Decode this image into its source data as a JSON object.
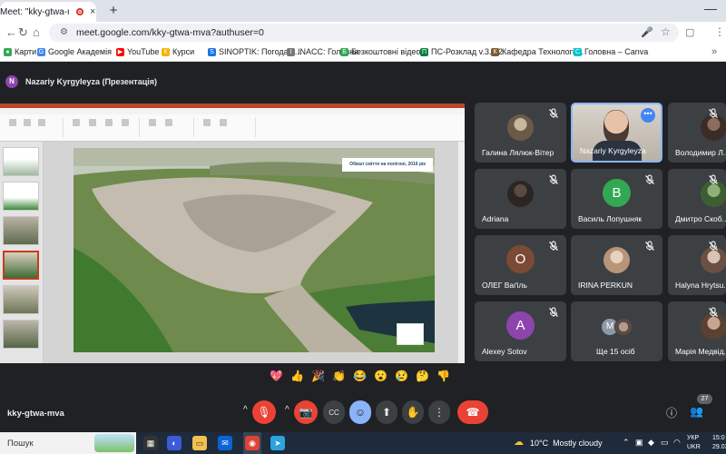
{
  "browser": {
    "tab_title": "Meet: \"kky-gtwa-mva\"",
    "tab_close": "×",
    "new_tab": "+",
    "minimize": "—",
    "url": "meet.google.com/kky-gtwa-mva?authuser=0",
    "back": "←",
    "forward": "→",
    "reload": "↻",
    "home": "⌂",
    "star": "☆",
    "menu": "⋮"
  },
  "bookmarks": [
    {
      "label": "Карти",
      "color": "#34a853",
      "glyph": "●"
    },
    {
      "label": "Google Академія",
      "color": "#4285f4",
      "glyph": "G"
    },
    {
      "label": "YouTube",
      "color": "#ff0000",
      "glyph": "▶"
    },
    {
      "label": "Курси",
      "color": "#f4b400",
      "glyph": "К"
    },
    {
      "label": "SINOPTIK: Погода в...",
      "color": "#1a73e8",
      "glyph": "S"
    },
    {
      "label": "INACC: Головна",
      "color": "#777777",
      "glyph": "I"
    },
    {
      "label": "Безкоштовні відео...",
      "color": "#34a853",
      "glyph": "Б"
    },
    {
      "label": "ПС-Розклад v.3.8.2",
      "color": "#0b8043",
      "glyph": "П"
    },
    {
      "label": "Кафедра Технології...",
      "color": "#7b5b2a",
      "glyph": "К"
    },
    {
      "label": "Головна – Canva",
      "color": "#00c4cc",
      "glyph": "C"
    }
  ],
  "bookmarks_more": "»",
  "presenter": {
    "initial": "N",
    "name": "Nazariy Kyrgyleyza (Презентація)"
  },
  "slide": {
    "caption": "Обвал сміття на полігоні, 2016 рік"
  },
  "participants": [
    {
      "name": "Галина Лялюк-Вітер",
      "type": "photo",
      "muted": true
    },
    {
      "name": "Nazariy Kyrgyleyza",
      "type": "video",
      "muted": false,
      "active": true
    },
    {
      "name": "Володимир Л...",
      "type": "photo",
      "muted": true
    },
    {
      "name": "Adriana",
      "type": "photo",
      "muted": true
    },
    {
      "name": "Василь Лопушняк",
      "type": "initial",
      "initial": "В",
      "color": "#33a852",
      "muted": true
    },
    {
      "name": "Дмитро Скоб...",
      "type": "photo",
      "muted": true
    },
    {
      "name": "ОЛЕГ Ваґіль",
      "type": "initial",
      "initial": "О",
      "color": "#7b4a35",
      "muted": true
    },
    {
      "name": "IRINA PERKUN",
      "type": "photo",
      "muted": true
    },
    {
      "name": "Halyna Hrytsu...",
      "type": "photo",
      "muted": true
    },
    {
      "name": "Alexey Sotov",
      "type": "initial",
      "initial": "A",
      "color": "#8e44ad",
      "muted": true
    },
    {
      "name": "Ще 15 осіб",
      "type": "stack",
      "initial": "M",
      "muted": false
    },
    {
      "name": "Марія Медвід...",
      "type": "photo",
      "muted": true
    }
  ],
  "reactions": [
    "💖",
    "👍",
    "🎉",
    "👏",
    "😂",
    "😮",
    "😢",
    "🤔",
    "👎"
  ],
  "meeting_code": "kky-gtwa-mva",
  "controls": {
    "chevron": "^",
    "mic_off": "🎙",
    "cam_off": "📷",
    "captions": "CC",
    "emoji": "☺",
    "present": "⬆",
    "raise_hand": "✋",
    "more": "⋮",
    "leave": "☎"
  },
  "info_icon": "ⓘ",
  "people_icon": "👥",
  "people_count": "27",
  "taskbar": {
    "search": "Пошук",
    "weather_temp": "10°C",
    "weather_desc": "Mostly cloudy",
    "lang_1": "УКР",
    "lang_2": "UKR",
    "time": "15:0",
    "date": "29.03.2"
  },
  "colors": {
    "meet_bg": "#202124",
    "tile_bg": "#3c4043",
    "end_call": "#ea4335",
    "accent_blue": "#8ab4f8"
  }
}
